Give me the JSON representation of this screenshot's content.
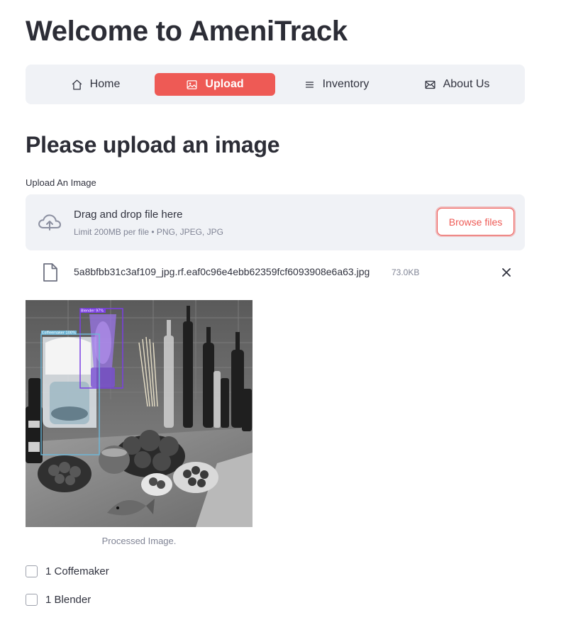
{
  "page": {
    "title": "Welcome to AmeniTrack"
  },
  "nav": {
    "items": [
      {
        "label": "Home",
        "icon": "home-icon"
      },
      {
        "label": "Upload",
        "icon": "image-icon",
        "active": true
      },
      {
        "label": "Inventory",
        "icon": "list-icon"
      },
      {
        "label": "About Us",
        "icon": "envelope-icon"
      }
    ]
  },
  "main": {
    "heading": "Please upload an image",
    "uploader": {
      "label": "Upload An Image",
      "drop_text": "Drag and drop file here",
      "limit_text": "Limit 200MB per file • PNG, JPEG, JPG",
      "browse_label": "Browse files",
      "icon": "cloud-upload-icon"
    },
    "file": {
      "name": "5a8bfbb31c3af109_jpg.rf.eaf0c96e4ebb62359fcf6093908e6a63.jpg",
      "size": "73.0KB",
      "icon": "file-icon"
    },
    "image": {
      "caption": "Processed Image.",
      "detections": [
        {
          "label": "Blender 97%",
          "color": "#7b3fe4"
        },
        {
          "label": "Coffeemaker 100%",
          "color": "#6fb6d6"
        }
      ]
    },
    "checkboxes": [
      {
        "label": "1 Coffemaker",
        "checked": false
      },
      {
        "label": "1 Blender",
        "checked": false
      }
    ]
  },
  "colors": {
    "accent": "#ee5a55",
    "panel": "#f0f2f6",
    "text": "#31333f",
    "muted": "#808495"
  }
}
